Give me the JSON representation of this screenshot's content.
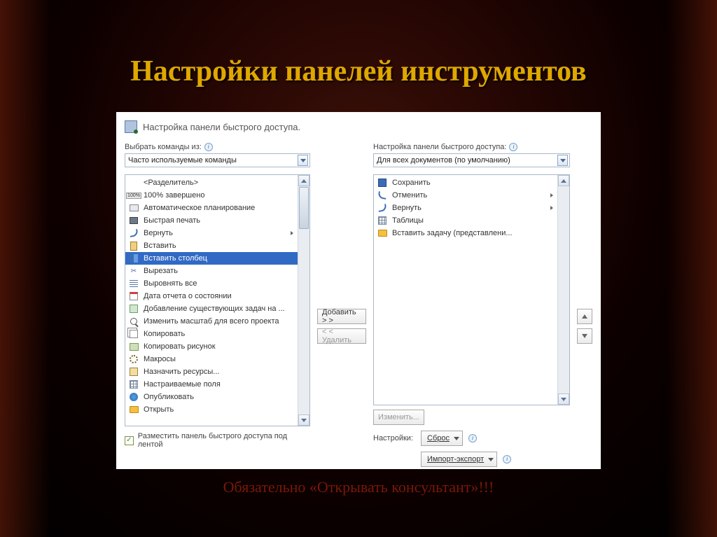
{
  "slide": {
    "title": "Настройки панелей инструментов",
    "footnote": "Обязательно «Открывать консультант»!!!"
  },
  "dialog": {
    "header": "Настройка панели быстрого доступа.",
    "left_label": "Выбрать команды из:",
    "right_label": "Настройка панели быстрого доступа:",
    "left_combo": "Часто используемые команды",
    "right_combo": "Для всех документов (по умолчанию)",
    "commands": [
      {
        "label": "<Разделитель>",
        "icon": ""
      },
      {
        "label": "100% завершено",
        "icon": "100"
      },
      {
        "label": "Автоматическое планирование",
        "icon": "plan"
      },
      {
        "label": "Быстрая печать",
        "icon": "print"
      },
      {
        "label": "Вернуть",
        "icon": "redo",
        "sub": true
      },
      {
        "label": "Вставить",
        "icon": "paste"
      },
      {
        "label": "Вставить столбец",
        "icon": "col",
        "selected": true
      },
      {
        "label": "Вырезать",
        "icon": "cut"
      },
      {
        "label": "Выровнять все",
        "icon": "align"
      },
      {
        "label": "Дата отчета о состоянии",
        "icon": "cal"
      },
      {
        "label": "Добавление существующих задач на ...",
        "icon": "add"
      },
      {
        "label": "Изменить масштаб для всего проекта",
        "icon": "zoom"
      },
      {
        "label": "Копировать",
        "icon": "copy"
      },
      {
        "label": "Копировать рисунок",
        "icon": "img"
      },
      {
        "label": "Макросы",
        "icon": "gear"
      },
      {
        "label": "Назначить ресурсы...",
        "icon": "res"
      },
      {
        "label": "Настраиваемые поля",
        "icon": "table"
      },
      {
        "label": "Опубликовать",
        "icon": "pub"
      },
      {
        "label": "Открыть",
        "icon": "folder"
      }
    ],
    "quick_access": [
      {
        "label": "Сохранить",
        "icon": "save"
      },
      {
        "label": "Отменить",
        "icon": "undo",
        "sub": true
      },
      {
        "label": "Вернуть",
        "icon": "redo",
        "sub": true
      },
      {
        "label": "Таблицы",
        "icon": "table"
      },
      {
        "label": "Вставить задачу (представлени...",
        "icon": "folder"
      }
    ],
    "btn_add": "Добавить > >",
    "btn_remove": "< < Удалить",
    "btn_modify": "Изменить...",
    "reset_label": "Настройки:",
    "btn_reset": "Сброс",
    "btn_import": "Импорт-экспорт",
    "checkbox_label": "Разместить панель быстрого доступа под лентой"
  }
}
